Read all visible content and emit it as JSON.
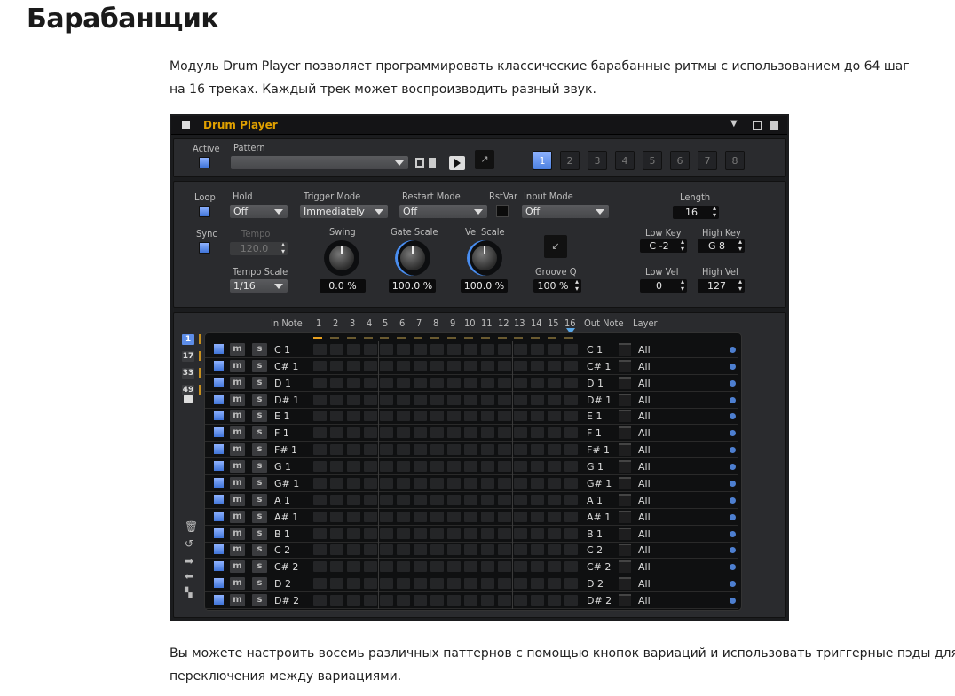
{
  "page": {
    "title": "Барабанщик",
    "intro": [
      "Модуль Drum Player позволяет программировать классические барабанные ритмы с использованием до 64 шаг",
      "на 16 треках. Каждый трек может воспроизводить разный звук."
    ],
    "outro": [
      "Вы можете настроить восемь различных паттернов с помощью кнопок вариаций и использовать триггерные пэды для",
      "переключения между вариациями."
    ]
  },
  "module": {
    "title": "Drum Player",
    "accent": "#e0a000",
    "active_color": "#5d8de8",
    "active_label": "Active",
    "pattern_label": "Pattern",
    "pattern_value": "",
    "variations": [
      "1",
      "2",
      "3",
      "4",
      "5",
      "6",
      "7",
      "8"
    ],
    "selected_variation": "1",
    "loop_label": "Loop",
    "sync_label": "Sync",
    "hold": {
      "label": "Hold",
      "value": "Off"
    },
    "trigger_mode": {
      "label": "Trigger Mode",
      "value": "Immediately"
    },
    "restart_mode": {
      "label": "Restart Mode",
      "value": "Off"
    },
    "rstvar_label": "RstVar",
    "input_mode": {
      "label": "Input Mode",
      "value": "Off"
    },
    "length": {
      "label": "Length",
      "value": "16"
    },
    "tempo": {
      "label": "Tempo",
      "value": "120.0"
    },
    "tempo_scale": {
      "label": "Tempo Scale",
      "value": "1/16"
    },
    "swing": {
      "label": "Swing",
      "value": "0.0 %"
    },
    "gate_scale": {
      "label": "Gate Scale",
      "value": "100.0 %"
    },
    "vel_scale": {
      "label": "Vel Scale",
      "value": "100.0 %"
    },
    "groove_q": {
      "label": "Groove Q",
      "value": "100 %"
    },
    "low_key": {
      "label": "Low Key",
      "value": "C -2"
    },
    "high_key": {
      "label": "High Key",
      "value": "G 8"
    },
    "low_vel": {
      "label": "Low Vel",
      "value": "0"
    },
    "high_vel": {
      "label": "High Vel",
      "value": "127"
    }
  },
  "sequencer": {
    "in_note_label": "In Note",
    "out_note_label": "Out Note",
    "layer_label": "Layer",
    "steps": [
      "1",
      "2",
      "3",
      "4",
      "5",
      "6",
      "7",
      "8",
      "9",
      "10",
      "11",
      "12",
      "13",
      "14",
      "15",
      "16"
    ],
    "banks": [
      "1",
      "17",
      "33",
      "49"
    ],
    "mute_label": "m",
    "solo_label": "s",
    "tracks": [
      {
        "in": "C 1",
        "out": "C 1",
        "layer": "All"
      },
      {
        "in": "C# 1",
        "out": "C# 1",
        "layer": "All"
      },
      {
        "in": "D 1",
        "out": "D 1",
        "layer": "All"
      },
      {
        "in": "D# 1",
        "out": "D# 1",
        "layer": "All"
      },
      {
        "in": "E 1",
        "out": "E 1",
        "layer": "All"
      },
      {
        "in": "F 1",
        "out": "F 1",
        "layer": "All"
      },
      {
        "in": "F# 1",
        "out": "F# 1",
        "layer": "All"
      },
      {
        "in": "G 1",
        "out": "G 1",
        "layer": "All"
      },
      {
        "in": "G# 1",
        "out": "G# 1",
        "layer": "All"
      },
      {
        "in": "A 1",
        "out": "A 1",
        "layer": "All"
      },
      {
        "in": "A# 1",
        "out": "A# 1",
        "layer": "All"
      },
      {
        "in": "B 1",
        "out": "B 1",
        "layer": "All"
      },
      {
        "in": "C 2",
        "out": "C 2",
        "layer": "All"
      },
      {
        "in": "C# 2",
        "out": "C# 2",
        "layer": "All"
      },
      {
        "in": "D 2",
        "out": "D 2",
        "layer": "All"
      },
      {
        "in": "D# 2",
        "out": "D# 2",
        "layer": "All"
      }
    ]
  }
}
